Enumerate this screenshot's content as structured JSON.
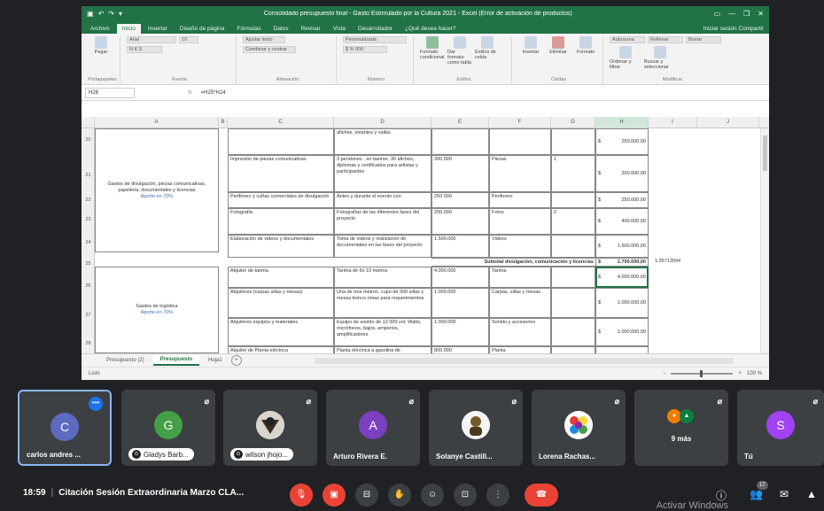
{
  "excel": {
    "quick_access": [
      "▣",
      "↶",
      "↷",
      "▾"
    ],
    "title": "Consolidado presupuesto final - Gasto Estimulado por la Cultura 2021 - Excel (Error de activación de productos)",
    "window_buttons": [
      "▭",
      "—",
      "❐",
      "✕"
    ],
    "menu_tabs": [
      "Archivo",
      "Inicio",
      "Insertar",
      "Diseño de página",
      "Fórmulas",
      "Datos",
      "Revisar",
      "Vista",
      "Desarrollador",
      "¿Qué desea hacer?"
    ],
    "active_menu_tab": "Inicio",
    "user_area": "Iniciar sesión   Compartir",
    "ribbon_groups": [
      {
        "label": "Portapapeles",
        "buttons": [
          "Pegar"
        ]
      },
      {
        "label": "Fuente",
        "buttons": [
          "Arial",
          "10",
          "N K S"
        ]
      },
      {
        "label": "Alineación",
        "buttons": [
          "Ajustar texto",
          "Combinar y centrar"
        ]
      },
      {
        "label": "Número",
        "buttons": [
          "Personalizada",
          "$ % 000"
        ]
      },
      {
        "label": "Estilos",
        "buttons": [
          "Formato condicional",
          "Dar formato como tabla",
          "Estilos de celda"
        ]
      },
      {
        "label": "Celdas",
        "buttons": [
          "Insertar",
          "Eliminar",
          "Formato"
        ]
      },
      {
        "label": "Modificar",
        "buttons": [
          "Autosuma",
          "Rellenar",
          "Borrar",
          "Ordenar y filtrar",
          "Buscar y seleccionar"
        ]
      }
    ],
    "name_box": "H26",
    "formula_value": "=H25*H24",
    "columns": [
      "A",
      "B",
      "C",
      "D",
      "E",
      "F",
      "G",
      "H",
      "I",
      "J"
    ],
    "rows": [
      "20",
      "21",
      "22",
      "23",
      "24",
      "25",
      "26",
      "27",
      "28"
    ],
    "section1": {
      "label": "Gastos de divulgación, piezas comunicativas, papelería, documentales y licencias",
      "sub": "Aporte en 70%"
    },
    "section2": {
      "label": "Gastos de logística",
      "sub": "Aporte en 70%"
    },
    "table_rows": [
      {
        "c": "",
        "d": "afiches, volantes y vallas",
        "e": "",
        "f": "",
        "g": "",
        "h_currency": "$",
        "h": "250.000,00"
      },
      {
        "c": "Impresión de piezas comunicativas",
        "d": "3 pendones ,  en banner, 30 afiches, diplomas y certificados para artistas y participantes",
        "e": "300.000",
        "f": "Piezas",
        "g": "1",
        "h_currency": "$",
        "h": "300.000,00"
      },
      {
        "c": "Perifoneo y cuñas comerciales de divulgación",
        "d": "Antes y durante el evento con",
        "e": "250.000",
        "f": "Perifoneo",
        "g": "",
        "h_currency": "$",
        "h": "250.000,00"
      },
      {
        "c": "Fotografía",
        "d": "Fotografías de las diferentes fases del proyecto.",
        "e": "200.000",
        "f": "Fotos",
        "g": "2",
        "h_currency": "$",
        "h": "400.000,00"
      },
      {
        "c": "Elaboración de videos y documentales",
        "d": "Toma de videos y realización de documentales en las fases del proyecto",
        "e": "1.500.000",
        "f": "Videos",
        "g": "",
        "h_currency": "$",
        "h": "1.500.000,00"
      },
      {
        "c": "Alquiler de tarima",
        "d": "Tarima de 6x 10 metros",
        "e": "4.000.000",
        "f": "Tarima",
        "g": "",
        "h_currency": "$",
        "h": "4.000.000,00"
      },
      {
        "c": "Alquileres (carpas sillas y mesas)",
        "d": "Una de tres metros, cupo de 300 sillas y mesas tronco rimax para requerimientos",
        "e": "1.000.000",
        "f": "Carpas, sillas y mesas",
        "g": "",
        "h_currency": "$",
        "h": "1.000.000,00"
      },
      {
        "c": "Alquileres equipos y materiales",
        "d": "Equipo de sonido de 12.000 vol. Watts, micrófonos, bajos, amperios, amplificadores",
        "e": "1.000.000",
        "f": "Sonido y accesorios",
        "g": "",
        "h_currency": "$",
        "h": "1.000.000,00"
      },
      {
        "c": "Alquiler de Planta eléctrica",
        "d": "Planta eléctrica a gasolina de",
        "e": "800.000",
        "f": "Planta",
        "g": "",
        "h_currency": "",
        "h": ""
      }
    ],
    "subtotal": {
      "label": "Subtotal divulgación, comunicación y licencias",
      "currency": "$",
      "value": "2.700.000,00",
      "extra": "1.35713994"
    },
    "sheet_tabs": [
      "Presupuesto (2)",
      "Presupuesto",
      "Hoja1"
    ],
    "active_sheet": "Presupuesto",
    "status_left": "Listo",
    "zoom": "100 %"
  },
  "participants": [
    {
      "name": "carlos andres ...",
      "initial": "C",
      "color": "#5c6bc0",
      "active": true
    },
    {
      "name": "Gladys Barb...",
      "initial": "G",
      "color": "#43a047"
    },
    {
      "name": "wilson jhojo...",
      "initial": "",
      "color": "#3c4043",
      "photo": true
    },
    {
      "name": "Arturo Rivera E.",
      "initial": "A",
      "color": "#7b3fbf"
    },
    {
      "name": "Solanye Castill...",
      "initial": "",
      "color": "#3c4043",
      "photo": true
    },
    {
      "name": "Lorena Rachas...",
      "initial": "",
      "color": "#3c4043",
      "photo": true
    },
    {
      "name": "9 más",
      "initial": "",
      "color": "#3c4043",
      "multi": true
    },
    {
      "name": "Tú",
      "initial": "S",
      "color": "#a142f4"
    }
  ],
  "bottombar": {
    "time": "18:59",
    "meeting_title": "Citación Sesión Extraordinaria Marzo CLA...",
    "people_count": "17",
    "controls": [
      "mic-off",
      "camera-off",
      "captions",
      "raise-hand",
      "reactions",
      "present",
      "more",
      "leave-call"
    ]
  },
  "watermark": "Activar Windows"
}
